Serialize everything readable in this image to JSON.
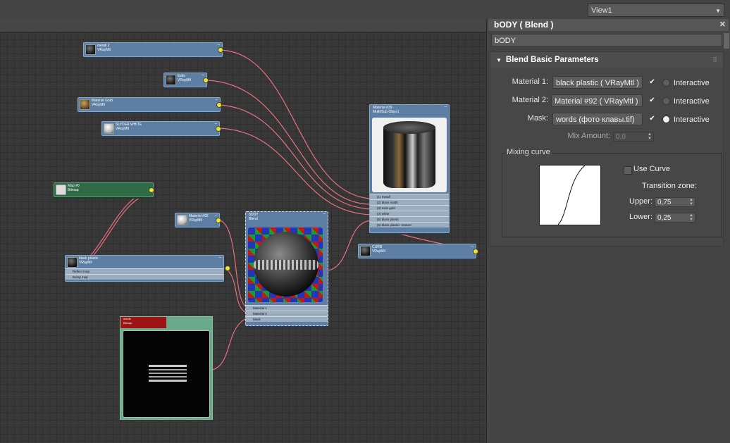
{
  "viewport": {
    "view_label": "View1"
  },
  "panel": {
    "title": "bODY  ( Blend )",
    "name_value": "bODY",
    "rollout_title": "Blend Basic Parameters",
    "material1": {
      "label": "Material 1:",
      "value": "black plastic  ( VRayMtl )",
      "checked": "✔",
      "interactive": "Interactive"
    },
    "material2": {
      "label": "Material 2:",
      "value": "Material #92  ( VRayMtl )",
      "checked": "✔",
      "interactive": "Interactive"
    },
    "mask": {
      "label": "Mask:",
      "value": "words (фото клавы.tif)",
      "checked": "✔",
      "interactive": "Interactive"
    },
    "mix_amount": {
      "label": "Mix Amount:",
      "value": "0,0"
    },
    "mixing_curve": {
      "title": "Mixing curve",
      "use_curve": "Use Curve",
      "transition_zone": "Transition zone:",
      "upper_label": "Upper:",
      "upper_value": "0,75",
      "lower_label": "Lower:",
      "lower_value": "0,25"
    }
  },
  "nodes": {
    "metall2": {
      "title": "metall 2",
      "sub": "VRayMtl"
    },
    "exits": {
      "title": "Exits",
      "sub": "VRayMtl"
    },
    "material_gold": {
      "title": "Material Gold",
      "sub": "VRayMtl"
    },
    "slyder_white": {
      "title": "SLYDER WHITE",
      "sub": "VRayMtl"
    },
    "map0": {
      "title": "Map #0",
      "sub": "Bitmap"
    },
    "material92": {
      "title": "Material #92",
      "sub": "VRayMtl"
    },
    "black_plastic": {
      "title": "black plastic",
      "sub": "VRayMtl",
      "slots": [
        "Reflect map",
        "Bump map"
      ]
    },
    "body": {
      "title": "bODY",
      "sub": "Blend",
      "slots": [
        "Material 1",
        "Material 2",
        "Mask"
      ]
    },
    "multisub": {
      "title": "Material #39",
      "sub": "Multi/Sub-Object",
      "slots": [
        "(1) metall",
        "(2) black matth",
        "(3) exits gold",
        "(4) white",
        "(5) black plastic",
        "(6) black plastic+ texture"
      ]
    },
    "curb": {
      "title": "CURB",
      "sub": "VRayMtl"
    },
    "words": {
      "title": "words",
      "sub": "Bitmap"
    }
  }
}
